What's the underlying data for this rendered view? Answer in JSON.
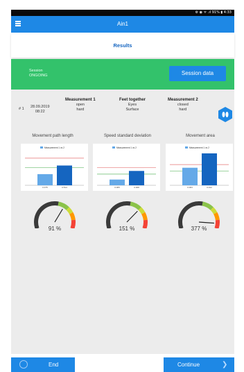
{
  "status_bar": {
    "text": "⚙ ◉ ᯤ .ıl 91% ▮ 4:33"
  },
  "app_bar": {
    "title": "Ain1"
  },
  "page_title": "Results",
  "session": {
    "label_line1": "Session",
    "label_line2": "ONGOING",
    "button_label": "Session data"
  },
  "measurement": {
    "number": "# 1",
    "date": "28.09.2019",
    "time": "08:22",
    "columns": [
      {
        "header": "Measurement 1",
        "line1": "open",
        "line2": "hard"
      },
      {
        "header": "Feet together",
        "line1": "Eyes",
        "line2": "Surface"
      },
      {
        "header": "Measurement 2",
        "line1": "closed",
        "line2": "hard"
      }
    ]
  },
  "charts": [
    {
      "title": "Movement path length",
      "legend": "Measurement 1 vs 2",
      "categories": [
        "0.475",
        "0.514"
      ],
      "values": [
        0.35,
        0.62
      ],
      "ref_lines": [
        0.85,
        0.55
      ]
    },
    {
      "title": "Speed standard deviation",
      "legend": "Measurement 1 vs 2",
      "categories": [
        "0.005",
        "0.008"
      ],
      "values": [
        0.18,
        0.45
      ],
      "ref_lines": [
        0.55,
        0.35
      ]
    },
    {
      "title": "Movement area",
      "legend": "Measurement 1 vs 2",
      "categories": [
        "0.003",
        "0.012"
      ],
      "values": [
        0.55,
        1.0
      ],
      "ref_lines": [
        0.65,
        0.45
      ]
    }
  ],
  "gauges": [
    {
      "value_text": "91 %",
      "value": 91
    },
    {
      "value_text": "151 %",
      "value": 151
    },
    {
      "value_text": "377 %",
      "value": 377
    }
  ],
  "colors": {
    "accent": "#1e88e5",
    "session_green": "#33c26b",
    "bar_light": "#64a9e8",
    "bar_dark": "#1565c0",
    "ref_red": "#e57373",
    "ref_green": "#66bb6a"
  },
  "footer": {
    "end_label": "End",
    "continue_label": "Continue"
  }
}
